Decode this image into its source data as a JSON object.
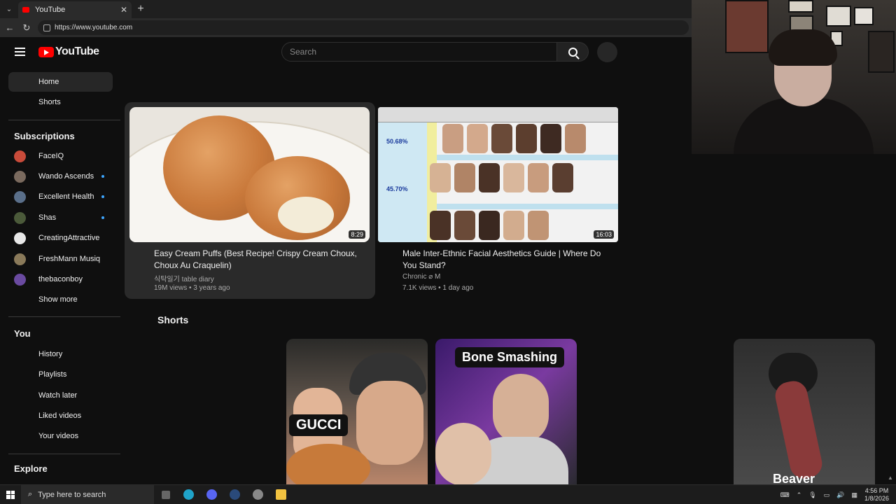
{
  "browser": {
    "tab_title": "YouTube",
    "url": "https://www.youtube.com"
  },
  "header": {
    "logo_text": "YouTube",
    "search_placeholder": "Search"
  },
  "sidebar": {
    "top": [
      "Home",
      "Shorts"
    ],
    "subscriptions_heading": "Subscriptions",
    "subscriptions": [
      {
        "name": "FaceIQ",
        "new": false,
        "color": "#c94b3a"
      },
      {
        "name": "Wando Ascends",
        "new": true,
        "color": "#7a6a5e"
      },
      {
        "name": "Excellent Health",
        "new": true,
        "color": "#5a6f8a"
      },
      {
        "name": "Shas",
        "new": true,
        "color": "#4b5a3a"
      },
      {
        "name": "CreatingAttractive",
        "new": false,
        "color": "#e8e8e8"
      },
      {
        "name": "FreshMann Musiq",
        "new": false,
        "color": "#8a7a5a"
      },
      {
        "name": "thebaconboy",
        "new": false,
        "color": "#6a4aa0"
      }
    ],
    "show_more": "Show more",
    "you_heading": "You",
    "you_items": [
      "History",
      "Playlists",
      "Watch later",
      "Liked videos",
      "Your videos"
    ],
    "explore_heading": "Explore"
  },
  "videos": [
    {
      "title_line1": "Easy Cream Puffs (Best Recipe! Crispy Cream Choux,",
      "title_line2": "Choux Au Craquelin)",
      "channel": "식탁일기 table diary",
      "meta": "19M views • 3 years ago",
      "duration": "8:29"
    },
    {
      "title_line1": "Male Inter-Ethnic Facial Aesthetics Guide | Where Do",
      "title_line2": "You Stand?",
      "channel": "Chronic ⌀ M",
      "meta": "7.1K views • 1 day ago",
      "duration": "16:03",
      "sheet_percents": [
        "50.68%",
        "45.70%"
      ]
    }
  ],
  "shorts": {
    "heading": "Shorts",
    "items": [
      {
        "label": "GUCCI"
      },
      {
        "label": "Bone Smashing"
      },
      {
        "label": "Beaver"
      }
    ]
  },
  "taskbar": {
    "search_placeholder": "Type here to search",
    "time": "4:56 PM",
    "date": "1/8/2026"
  }
}
